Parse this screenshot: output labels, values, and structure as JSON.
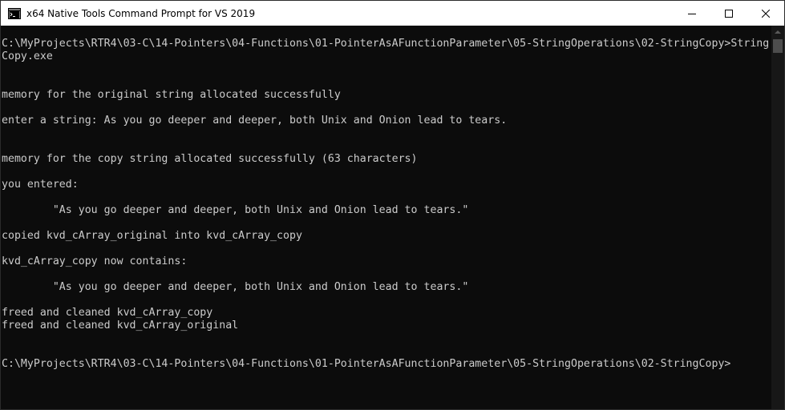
{
  "window": {
    "title": "x64 Native Tools Command Prompt for VS 2019",
    "icon": "command-prompt-icon"
  },
  "controls": {
    "minimize_icon": "minimize-icon",
    "maximize_icon": "maximize-icon",
    "close_icon": "close-icon"
  },
  "console": {
    "lines": [
      "C:\\MyProjects\\RTR4\\03-C\\14-Pointers\\04-Functions\\01-PointerAsAFunctionParameter\\05-StringOperations\\02-StringCopy>String",
      "Copy.exe",
      "memory for the original string allocated successfully",
      "enter a string: As you go deeper and deeper, both Unix and Onion lead to tears.",
      "memory for the copy string allocated successfully (63 characters)",
      "you entered:",
      "        \"As you go deeper and deeper, both Unix and Onion lead to tears.\"",
      "copied kvd_cArray_original into kvd_cArray_copy",
      "kvd_cArray_copy now contains:",
      "        \"As you go deeper and deeper, both Unix and Onion lead to tears.\"",
      "freed and cleaned kvd_cArray_copy",
      "freed and cleaned kvd_cArray_original",
      "C:\\MyProjects\\RTR4\\03-C\\14-Pointers\\04-Functions\\01-PointerAsAFunctionParameter\\05-StringOperations\\02-StringCopy>"
    ]
  },
  "colors": {
    "background": "#0c0c0c",
    "text": "#cccccc",
    "titlebar": "#ffffff"
  }
}
